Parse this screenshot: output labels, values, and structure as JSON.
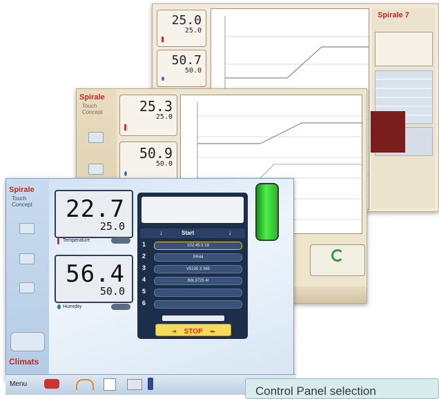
{
  "back": {
    "temp_main": "25.0",
    "temp_set": "25.0",
    "hum_main": "50.7",
    "hum_set": "50.0",
    "logo": "Spirale 7"
  },
  "mid": {
    "logo": "Spirale",
    "subtitle": "Touch Concept",
    "temp_main": "25.3",
    "temp_set": "25.0",
    "hum_main": "50.9",
    "hum_set": "50.0"
  },
  "front": {
    "logo": "Spirale",
    "subtitle": "Touch Concept",
    "temp_main": "22.7",
    "temp_set": "25.0",
    "temperature_label": "Temperature",
    "hum_main": "56.4",
    "hum_set": "50.0",
    "humidity_label": "Humidity",
    "start_label": "Start",
    "stop_label": "STOP",
    "program_rows": [
      {
        "num": "1",
        "text": "102:45:3 19"
      },
      {
        "num": "2",
        "text": "PR44"
      },
      {
        "num": "3",
        "text": "V5235 3 365"
      },
      {
        "num": "4",
        "text": "B8L3725 4I"
      },
      {
        "num": "5",
        "text": ""
      },
      {
        "num": "6",
        "text": ""
      }
    ],
    "brand": "Climats",
    "menu_label": "Menu"
  },
  "caption": "Control Panel selection",
  "colors": {
    "brand_red": "#c0282a",
    "panel_navy": "#1c2e4a",
    "led_green": "#4ef04a"
  }
}
